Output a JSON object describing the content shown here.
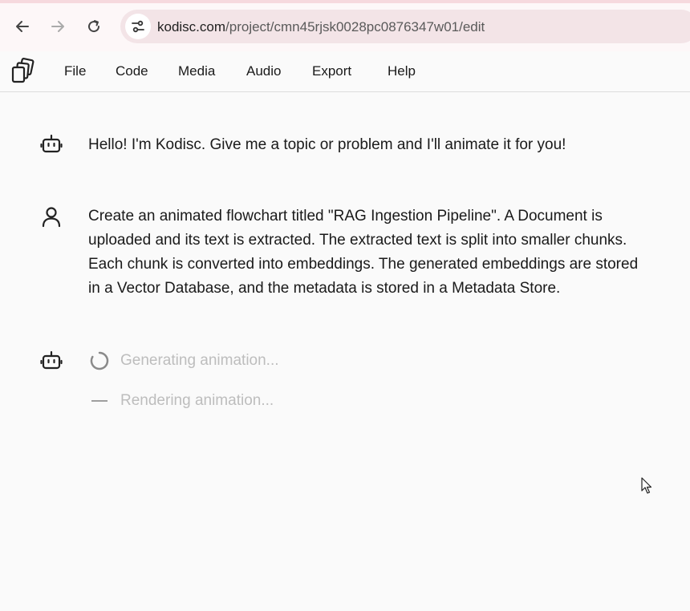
{
  "browser": {
    "url_host": "kodisc.com",
    "url_path": "/project/cmn45rjsk0028pc0876347w01/edit"
  },
  "menu": {
    "items": [
      "File",
      "Code",
      "Media",
      "Audio",
      "Export",
      "Help"
    ]
  },
  "chat": {
    "messages": [
      {
        "role": "assistant",
        "icon": "bot-icon",
        "text": "Hello! I'm Kodisc. Give me a topic or problem and I'll animate it for you!"
      },
      {
        "role": "user",
        "icon": "user-icon",
        "lines": [
          "Create an animated flowchart titled \"RAG Ingestion Pipeline\". A Document is",
          "uploaded and its text is extracted. The extracted text is split into smaller chunks.",
          "Each chunk is converted into embeddings. The generated embeddings are stored",
          "in a Vector Database, and the metadata is stored in a Metadata Store."
        ]
      }
    ],
    "status": {
      "icon": "bot-icon",
      "generating": "Generating animation...",
      "rendering": "Rendering animation..."
    }
  }
}
